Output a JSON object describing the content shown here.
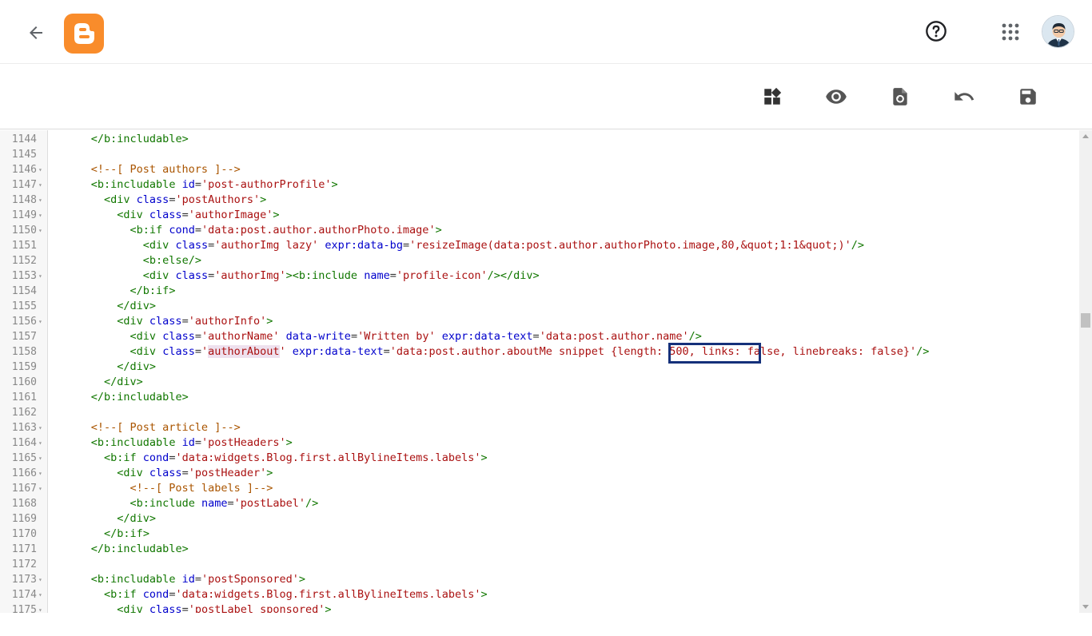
{
  "header": {
    "back_icon": "arrow-left-icon",
    "logo_icon": "blogger-logo-icon",
    "help_icon": "help-circle-icon",
    "apps_icon": "apps-grid-icon",
    "avatar_icon": "user-avatar-icon",
    "brand_color": "#f98c2b"
  },
  "toolbar": {
    "buttons": [
      {
        "name": "jump-to-widget-button",
        "icon": "widgets-icon"
      },
      {
        "name": "preview-button",
        "icon": "eye-icon"
      },
      {
        "name": "restore-button",
        "icon": "restore-file-icon"
      },
      {
        "name": "undo-button",
        "icon": "undo-icon"
      },
      {
        "name": "save-button",
        "icon": "save-icon"
      }
    ]
  },
  "editor": {
    "lines": [
      {
        "n": "1144",
        "fold": "",
        "t": "      </b:includable>"
      },
      {
        "n": "1145",
        "fold": "",
        "t": ""
      },
      {
        "n": "1146",
        "fold": "▾",
        "t": "      <!--[ Post authors ]-->"
      },
      {
        "n": "1147",
        "fold": "▾",
        "t": "      <b:includable id='post-authorProfile'>"
      },
      {
        "n": "1148",
        "fold": "▾",
        "t": "        <div class='postAuthors'>"
      },
      {
        "n": "1149",
        "fold": "▾",
        "t": "          <div class='authorImage'>"
      },
      {
        "n": "1150",
        "fold": "▾",
        "t": "            <b:if cond='data:post.author.authorPhoto.image'>"
      },
      {
        "n": "1151",
        "fold": "",
        "t": "              <div class='authorImg lazy' expr:data-bg='resizeImage(data:post.author.authorPhoto.image,80,&quot;1:1&quot;)'/>"
      },
      {
        "n": "1152",
        "fold": "",
        "t": "              <b:else/>"
      },
      {
        "n": "1153",
        "fold": "▾",
        "t": "              <div class='authorImg'><b:include name='profile-icon'/></div>"
      },
      {
        "n": "1154",
        "fold": "",
        "t": "            </b:if>"
      },
      {
        "n": "1155",
        "fold": "",
        "t": "          </div>"
      },
      {
        "n": "1156",
        "fold": "▾",
        "t": "          <div class='authorInfo'>"
      },
      {
        "n": "1157",
        "fold": "",
        "t": "            <div class='authorName' data-write='Written by' expr:data-text='data:post.author.name'/>"
      },
      {
        "n": "1158",
        "fold": "",
        "t": "            <div class='authorAbout' expr:data-text='data:post.author.aboutMe snippet {length: 500, links: false, linebreaks: false}'/>"
      },
      {
        "n": "1159",
        "fold": "",
        "t": "          </div>"
      },
      {
        "n": "1160",
        "fold": "",
        "t": "        </div>"
      },
      {
        "n": "1161",
        "fold": "",
        "t": "      </b:includable>"
      },
      {
        "n": "1162",
        "fold": "",
        "t": ""
      },
      {
        "n": "1163",
        "fold": "▾",
        "t": "      <!--[ Post article ]-->"
      },
      {
        "n": "1164",
        "fold": "▾",
        "t": "      <b:includable id='postHeaders'>"
      },
      {
        "n": "1165",
        "fold": "▾",
        "t": "        <b:if cond='data:widgets.Blog.first.allBylineItems.labels'>"
      },
      {
        "n": "1166",
        "fold": "▾",
        "t": "          <div class='postHeader'>"
      },
      {
        "n": "1167",
        "fold": "▾",
        "t": "            <!--[ Post labels ]-->"
      },
      {
        "n": "1168",
        "fold": "",
        "t": "            <b:include name='postLabel'/>"
      },
      {
        "n": "1169",
        "fold": "",
        "t": "          </div>"
      },
      {
        "n": "1170",
        "fold": "",
        "t": "        </b:if>"
      },
      {
        "n": "1171",
        "fold": "",
        "t": "      </b:includable>"
      },
      {
        "n": "1172",
        "fold": "",
        "t": ""
      },
      {
        "n": "1173",
        "fold": "▾",
        "t": "      <b:includable id='postSponsored'>"
      },
      {
        "n": "1174",
        "fold": "▾",
        "t": "        <b:if cond='data:widgets.Blog.first.allBylineItems.labels'>"
      },
      {
        "n": "1175",
        "fold": "▾",
        "t": "          <div class='postLabel sponsored'>"
      }
    ],
    "search_highlight": "authorAbout",
    "annotation_box_color": "#15307a"
  }
}
